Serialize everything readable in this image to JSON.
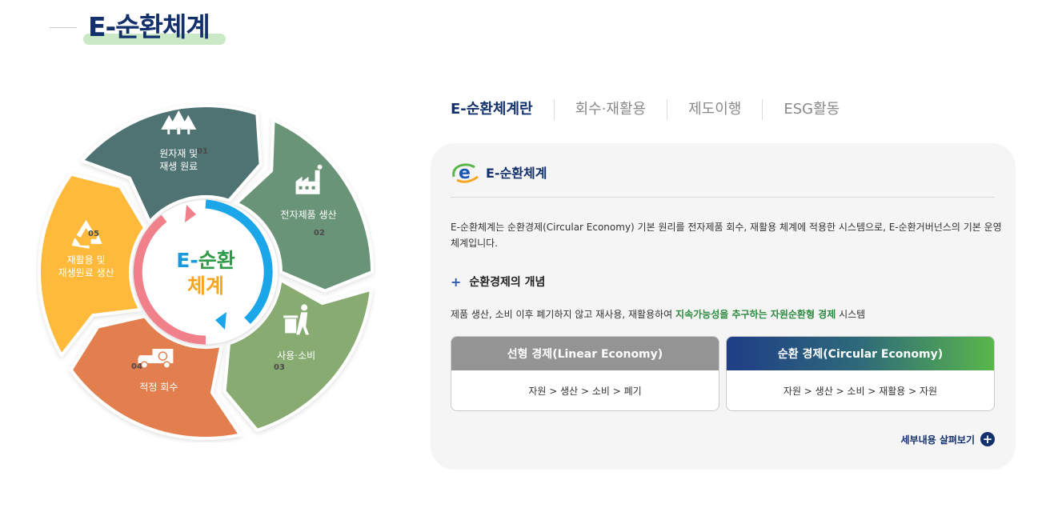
{
  "header": {
    "title": "E-순환체계"
  },
  "cycle": {
    "center_line1_a": "E-",
    "center_line1_b": "순환",
    "center_line2": "체계",
    "segments": [
      {
        "num": "01",
        "line1": "원자재 및",
        "line2": "재생 원료",
        "icon": "trees-icon",
        "color": "#4f7272"
      },
      {
        "num": "02",
        "line1": "전자제품 생산",
        "line2": "",
        "icon": "factory-icon",
        "color": "#6a9478"
      },
      {
        "num": "03",
        "line1": "사용·소비",
        "line2": "",
        "icon": "trash-person-icon",
        "color": "#88ab72"
      },
      {
        "num": "04",
        "line1": "적정 회수",
        "line2": "",
        "icon": "truck-icon",
        "color": "#e37f4f"
      },
      {
        "num": "05",
        "line1": "재활용 및",
        "line2": "재생원료 생산",
        "icon": "recycle-icon",
        "color": "#ffb93b"
      }
    ]
  },
  "tabs": [
    {
      "label": "E-순환체계란",
      "active": true
    },
    {
      "label": "회수·재활용",
      "active": false
    },
    {
      "label": "제도이행",
      "active": false
    },
    {
      "label": "ESG활동",
      "active": false
    }
  ],
  "card": {
    "title": "E-순환체계",
    "description": "E-순환체계는 순환경제(Circular Economy) 기본 원리를 전자제품 회수, 재활용 체계에 적용한 시스템으로, E-순환거버넌스의 기본 운영 체계입니다.",
    "concept_title": "순환경제의 개념",
    "definition_pre": "제품 생산, 소비 이후 폐기하지 않고 재사용, 재활용하여 ",
    "definition_highlight": "지속가능성을 추구하는 자원순환형 경제",
    "definition_post": " 시스템",
    "linear": {
      "title": "선형 경제(Linear Economy)",
      "flow": "자원 > 생산 > 소비 > 폐기"
    },
    "circular": {
      "title": "순환 경제(Circular Economy)",
      "flow": "자원 > 생산 > 소비 > 재활용 > 자원"
    },
    "more_label": "세부내용 살펴보기"
  },
  "colors": {
    "navy": "#12306b",
    "green_highlight": "#2b8a3e",
    "arrow_blue": "#1aa6e8",
    "arrow_pink": "#f0808a",
    "center_blue": "#1a9ad6",
    "center_green": "#2f9a48",
    "center_orange": "#f5a623"
  }
}
